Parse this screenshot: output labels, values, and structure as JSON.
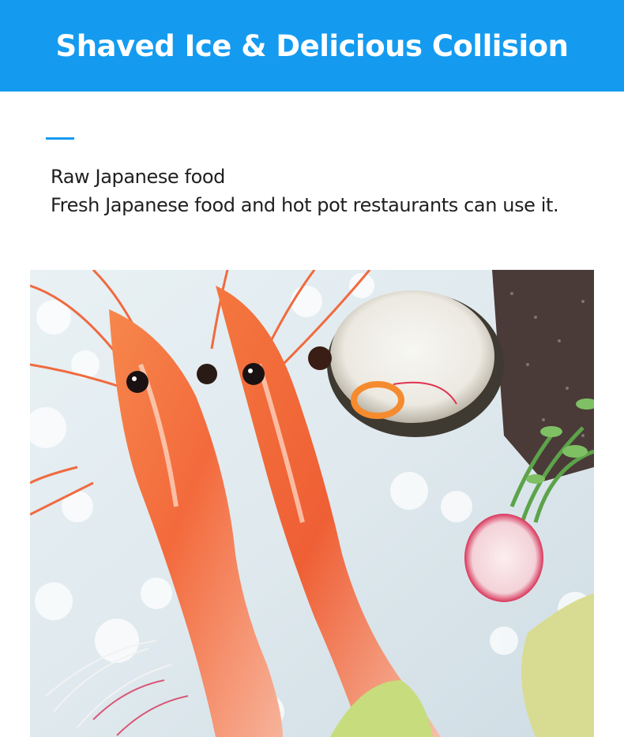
{
  "banner": {
    "title": "Shaved Ice & Delicious Collision",
    "color": "#149bf0"
  },
  "description": {
    "line1": "Raw Japanese food",
    "line2": "Fresh Japanese food and hot pot restaurants can use it."
  },
  "photo": {
    "subject": "raw-shrimp-on-shaved-ice-photo"
  }
}
